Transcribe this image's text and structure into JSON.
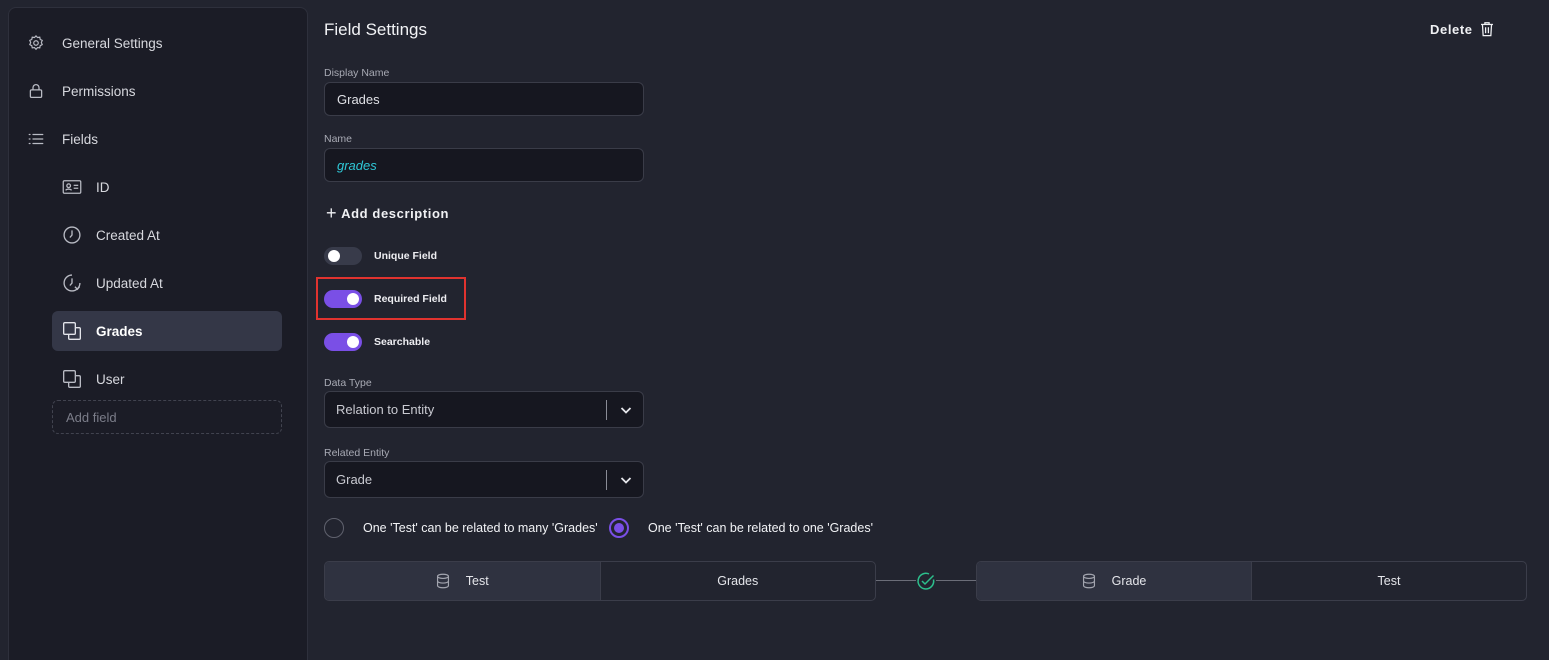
{
  "sidebar": {
    "items": [
      {
        "label": "General Settings",
        "icon": "gear-icon"
      },
      {
        "label": "Permissions",
        "icon": "lock-icon"
      },
      {
        "label": "Fields",
        "icon": "list-icon"
      }
    ],
    "fields": [
      {
        "label": "ID",
        "icon": "id-card-icon"
      },
      {
        "label": "Created At",
        "icon": "clock-icon"
      },
      {
        "label": "Updated At",
        "icon": "clock-refresh-icon"
      },
      {
        "label": "Grades",
        "icon": "relation-icon",
        "active": true
      },
      {
        "label": "User",
        "icon": "relation-icon"
      }
    ],
    "add_field_placeholder": "Add field"
  },
  "main": {
    "title": "Field Settings",
    "delete_label": "Delete",
    "display_name_label": "Display Name",
    "display_name_value": "Grades",
    "name_label": "Name",
    "name_value": "grades",
    "add_description_label": "Add description",
    "toggles": [
      {
        "label": "Unique Field",
        "on": false
      },
      {
        "label": "Required Field",
        "on": true
      },
      {
        "label": "Searchable",
        "on": true
      }
    ],
    "data_type_label": "Data Type",
    "data_type_value": "Relation to Entity",
    "related_entity_label": "Related Entity",
    "related_entity_value": "Grade",
    "relation_options": [
      {
        "label": "One 'Test' can be related to many 'Grades'",
        "checked": false
      },
      {
        "label": "One 'Test' can be related to one 'Grades'",
        "checked": true
      }
    ],
    "relation_left": {
      "entity": "Test",
      "field": "Grades"
    },
    "relation_right": {
      "entity": "Grade",
      "field": "Test"
    }
  },
  "colors": {
    "accent": "#7a4fe6",
    "name_text": "#2fc7d6",
    "highlight": "#e0332f",
    "connector_check": "#2cbf8c"
  }
}
